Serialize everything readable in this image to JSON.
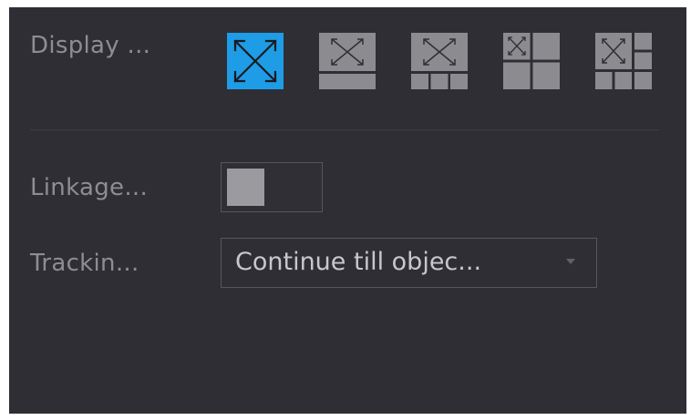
{
  "display_mode": {
    "label": "Display ...",
    "options": [
      {
        "name": "single-view",
        "icon": "expand-arrows-icon",
        "selected": true
      },
      {
        "name": "1-plus-1",
        "icon": "layout-1-plus-1-icon",
        "selected": false
      },
      {
        "name": "1-plus-3",
        "icon": "layout-1-plus-3-icon",
        "selected": false
      },
      {
        "name": "quad",
        "icon": "layout-quad-icon",
        "selected": false
      },
      {
        "name": "1-plus-5",
        "icon": "layout-1-plus-5-icon",
        "selected": false
      }
    ]
  },
  "linkage": {
    "label": "Linkage...",
    "enabled": false
  },
  "tracking": {
    "label": "Trackin...",
    "value": "Continue till objec..."
  },
  "colors": {
    "background": "#2e2e34",
    "selected_accent": "#1e9ce6",
    "tile_gray": "#8c8c90",
    "label_text": "#8d8d92",
    "value_text": "#c8c8cc"
  }
}
